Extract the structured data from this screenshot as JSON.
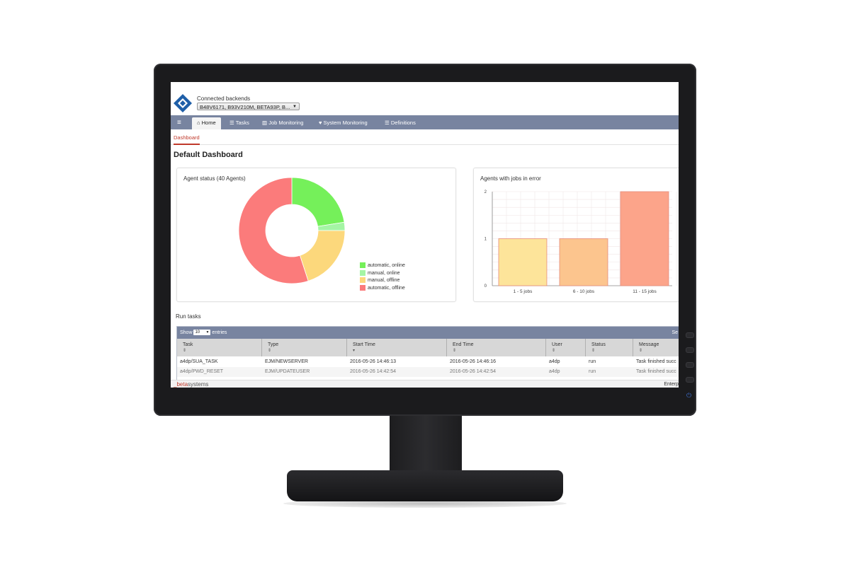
{
  "header": {
    "connected_label": "Connected backends",
    "backends_value": "B48V6171, B93V210M, BETA93P, B..."
  },
  "nav": {
    "items": [
      {
        "label": "Home",
        "icon": "home-icon"
      },
      {
        "label": "Tasks",
        "icon": "list-icon"
      },
      {
        "label": "Job Monitoring",
        "icon": "bar-chart-icon"
      },
      {
        "label": "System Monitoring",
        "icon": "heart-icon"
      },
      {
        "label": "Definitions",
        "icon": "list-icon"
      }
    ]
  },
  "subnav": {
    "active_tab": "Dashboard"
  },
  "page": {
    "title": "Default Dashboard"
  },
  "colors": {
    "nav_bg": "#7884a0",
    "accent": "#c0392b"
  },
  "chart_data": [
    {
      "type": "pie",
      "variant": "donut",
      "title": "Agent status (40 Agents)",
      "legend_position": "bottom-right",
      "slices": [
        {
          "label": "automatic, online",
          "value": 9,
          "color": "#75f05a"
        },
        {
          "label": "manual, online",
          "value": 1,
          "color": "#a4f5a4"
        },
        {
          "label": "manual, offline",
          "value": 8,
          "color": "#fcd87c"
        },
        {
          "label": "automatic, offline",
          "value": 22,
          "color": "#fb7b7b"
        }
      ]
    },
    {
      "type": "bar",
      "title": "Agents with jobs in error",
      "categories": [
        "1 - 5 jobs",
        "6 - 10 jobs",
        "11 - 15 jobs"
      ],
      "values": [
        1,
        1,
        2
      ],
      "colors": [
        "#fde49a",
        "#fcc58e",
        "#fca48a"
      ],
      "ylim": [
        0,
        2
      ],
      "yticks": [
        0,
        1,
        2
      ],
      "grid": true
    }
  ],
  "run_tasks": {
    "title": "Run tasks",
    "show_label": "Show",
    "entries_value": "10",
    "entries_label": "entries",
    "search_partial": "Se",
    "columns": [
      "Task",
      "Type",
      "Start Time",
      "End Time",
      "User",
      "Status",
      "Message"
    ],
    "rows": [
      [
        "a4dp/SUA_TASK",
        "EJM/NEWSERVER",
        "2016-05-26 14:46:13",
        "2016-05-26 14:46:16",
        "a4dp",
        "run",
        "Task finished succ"
      ],
      [
        "a4dp/PWD_RESET",
        "EJM/UPDATEUSER",
        "2016-05-26 14:42:54",
        "2016-05-26 14:42:54",
        "a4dp",
        "run",
        "Task finished succ"
      ]
    ]
  },
  "footer": {
    "brand_prefix": "_beta",
    "brand_suffix": "systems",
    "right_text": "Enterp"
  }
}
